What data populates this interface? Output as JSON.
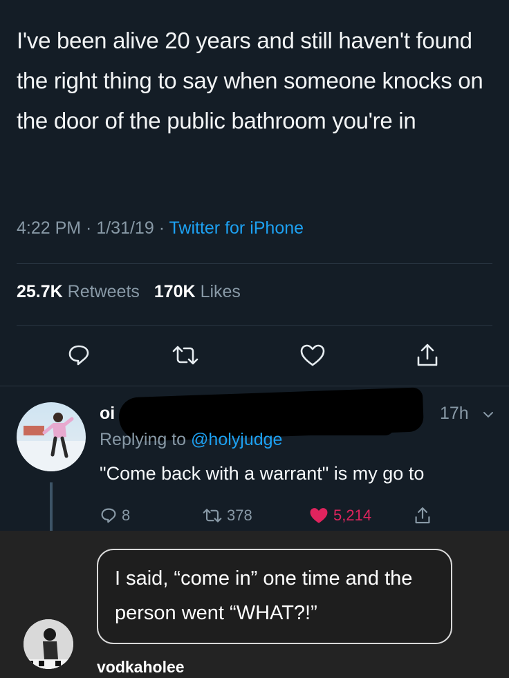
{
  "tweet": {
    "text": "I've been alive 20 years and still haven't found the right thing to say when someone knocks on the door of the public bathroom you're in",
    "time": "4:22 PM",
    "date": "1/31/19",
    "source": "Twitter for iPhone",
    "retweets_count": "25.7K",
    "retweets_label": "Retweets",
    "likes_count": "170K",
    "likes_label": "Likes"
  },
  "reply": {
    "name": "oi",
    "time": "17h",
    "replying_prefix": "Replying to",
    "replying_handle": "@holyjudge",
    "text": "\"Come back with a warrant\" is my go to",
    "replies": "8",
    "retweets": "378",
    "likes": "5,214"
  },
  "comment": {
    "text": "I said, “come in” one time and the person went “WHAT?!”",
    "username": "vodkaholee"
  },
  "colors": {
    "background": "#141d26",
    "accent": "#1da1f2",
    "secondary_text": "#8899a6",
    "like": "#e0245e"
  }
}
